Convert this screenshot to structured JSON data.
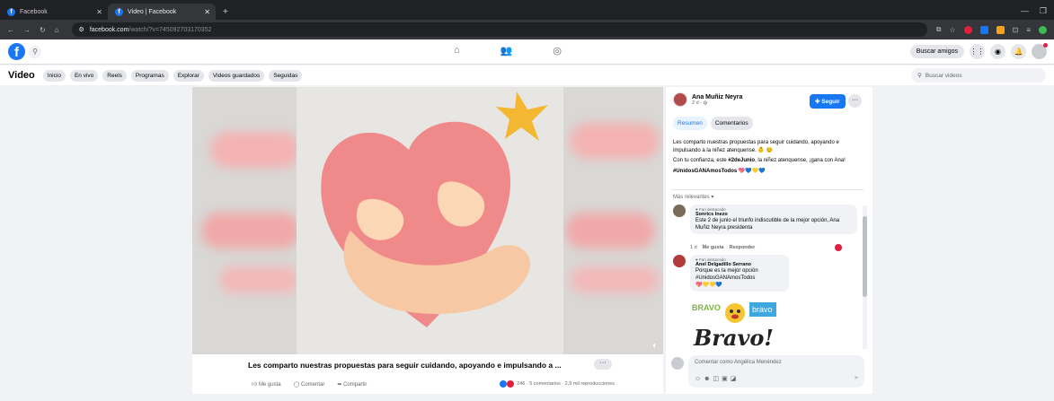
{
  "browser": {
    "tabs": [
      {
        "label": "Facebook",
        "active": false
      },
      {
        "label": "Video | Facebook",
        "active": true
      }
    ],
    "new_tab": "+",
    "url_host": "facebook.com",
    "url_path": "/watch/?v=745092703170352"
  },
  "fb_header": {
    "logo": "f",
    "nav_icons": [
      "home-icon",
      "friends-icon",
      "groups-icon"
    ],
    "find_friends": "Buscar amigos"
  },
  "video_nav": {
    "title": "Video",
    "tabs": [
      "Inicio",
      "En vivo",
      "Reels",
      "Programas",
      "Explorar",
      "Videos guardados",
      "Seguidas"
    ],
    "search_placeholder": "Buscar videos"
  },
  "video": {
    "caption": "Les comparto nuestras propuestas para seguir cuidando, apoyando e impulsando a ...",
    "more": "···",
    "like": "Me gusta",
    "comment": "Comentar",
    "share": "Compartir",
    "stats": "246 · 5 comentarios · 2,9 mil reproducciones"
  },
  "post": {
    "author": "Ana Muñiz Neyra",
    "date": "2 d · ",
    "follow": "Seguir",
    "tabs": [
      "Resumen",
      "Comentarios"
    ],
    "text1": "Les comparto nuestras propuestas para seguir cuidando, apoyando e impulsando a la niñez atenquense. 👶 😊",
    "text2_a": "Con tu confianza, este ",
    "text2_tag": "#2deJunio",
    "text2_b": ", la niñez atenquense, ¡gana con Ana!",
    "hashtag": "#UnidosGANAmosTodos 💖💙💛💙",
    "sort": "Más relevantes ▾"
  },
  "comments": [
    {
      "badge": "Fan destacado",
      "name": "Sonrics Inezo",
      "text": "Este 2 de junio el triunfo indiscutible de la mejor opción, Ana Muñiz Neyra presidenta",
      "time": "1 d",
      "like": "Me gusta",
      "reply": "Responder"
    },
    {
      "badge": "Fan destacado",
      "name": "Anel Delgadillo Serrano",
      "text": "Porque es la mejor opción #UnidosGANAmosTodos",
      "hearts": "💖💛💛💙"
    }
  ],
  "sticker": {
    "label": "Bravo!",
    "top1": "BRAVO",
    "top2": "bravo"
  },
  "composer": {
    "placeholder": "Comentar como Angélica Menéndez"
  },
  "colors": {
    "brand": "#1877f2",
    "accent_red": "#e41e3f",
    "heart_pink": "#f08a8a"
  }
}
